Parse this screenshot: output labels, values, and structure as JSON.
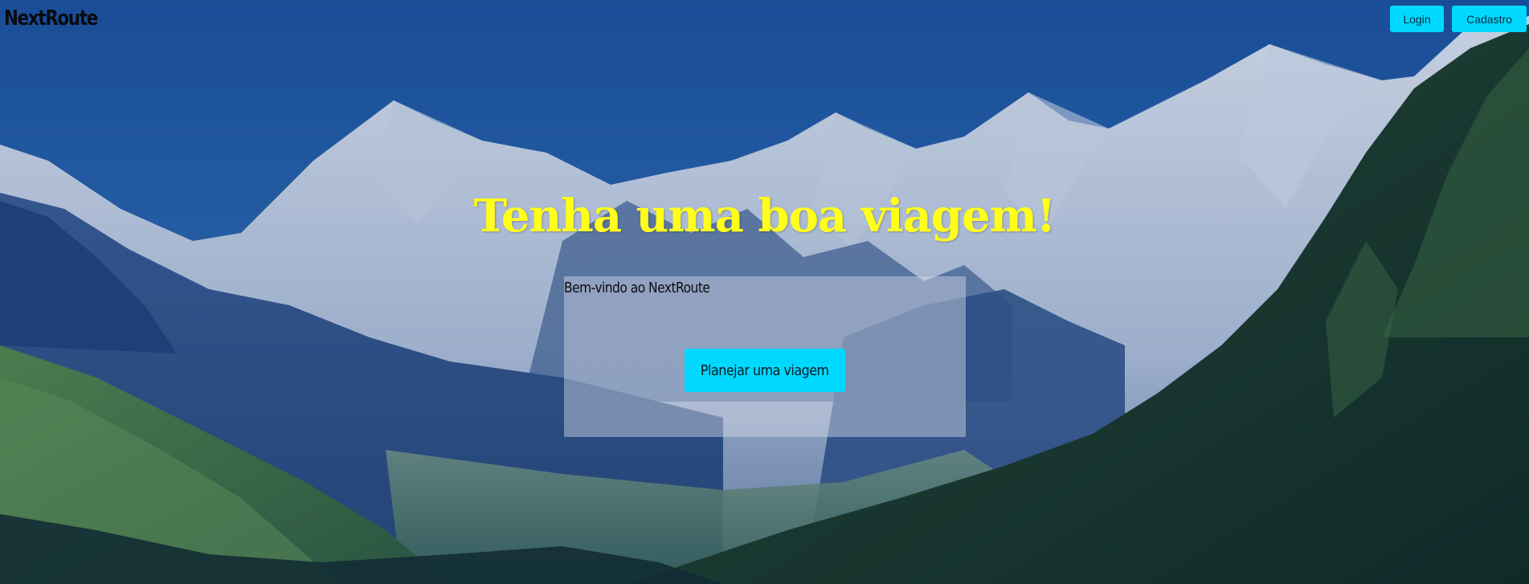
{
  "header": {
    "brand": "NextRoute",
    "nav": {
      "login_label": "Login",
      "signup_label": "Cadastro"
    }
  },
  "hero": {
    "title": "Tenha uma boa viagem!",
    "card": {
      "welcome_text": "Bem-vindo ao NextRoute",
      "cta_label": "Planejar uma viagem"
    }
  },
  "colors": {
    "accent": "#00d8ff",
    "title": "#ffff1a",
    "sky": "#1f5aa6"
  },
  "icons": {
    "background": "mountain-landscape-image"
  }
}
